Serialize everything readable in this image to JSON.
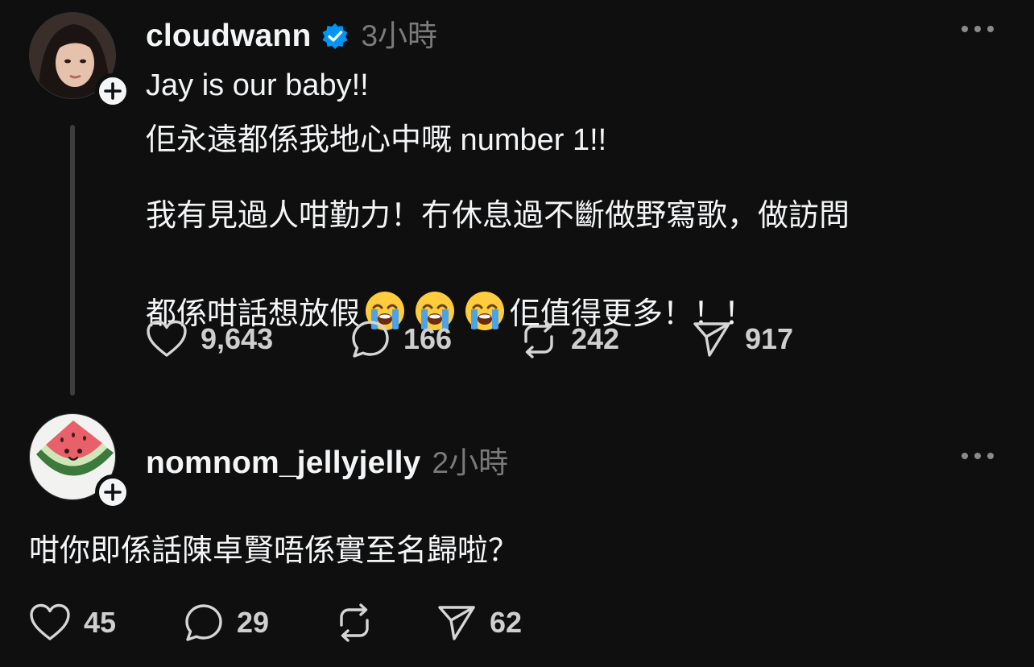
{
  "posts": [
    {
      "username": "cloudwann",
      "verified": true,
      "time": "3小時",
      "line1": "Jay is our baby!!",
      "line2": "佢永遠都係我地心中嘅 number 1!!",
      "line3": "我有見過人咁勤力！冇休息過不斷做野寫歌，做訪問",
      "line4a": "都係咁話想放假",
      "line4b": "佢值得更多！！！",
      "emoji": "loudly-crying-face",
      "likes": "9,643",
      "replies": "166",
      "reposts": "242",
      "shares": "917"
    },
    {
      "username": "nomnom_jellyjelly",
      "verified": false,
      "time": "2小時",
      "text": "咁你即係話陳卓賢唔係實至名歸啦？",
      "likes": "45",
      "replies": "29",
      "reposts": "",
      "shares": "62"
    }
  ],
  "icons": {
    "like": "heart-icon",
    "reply": "comment-bubble-icon",
    "repost": "repost-icon",
    "share": "send-icon",
    "more": "more-dots-icon",
    "follow": "plus-icon",
    "verified": "verified-badge-icon"
  },
  "colors": {
    "background": "#0f0f0f",
    "text": "#f3f5f7",
    "secondary": "#7a7a7a",
    "verified": "#0095f6"
  }
}
